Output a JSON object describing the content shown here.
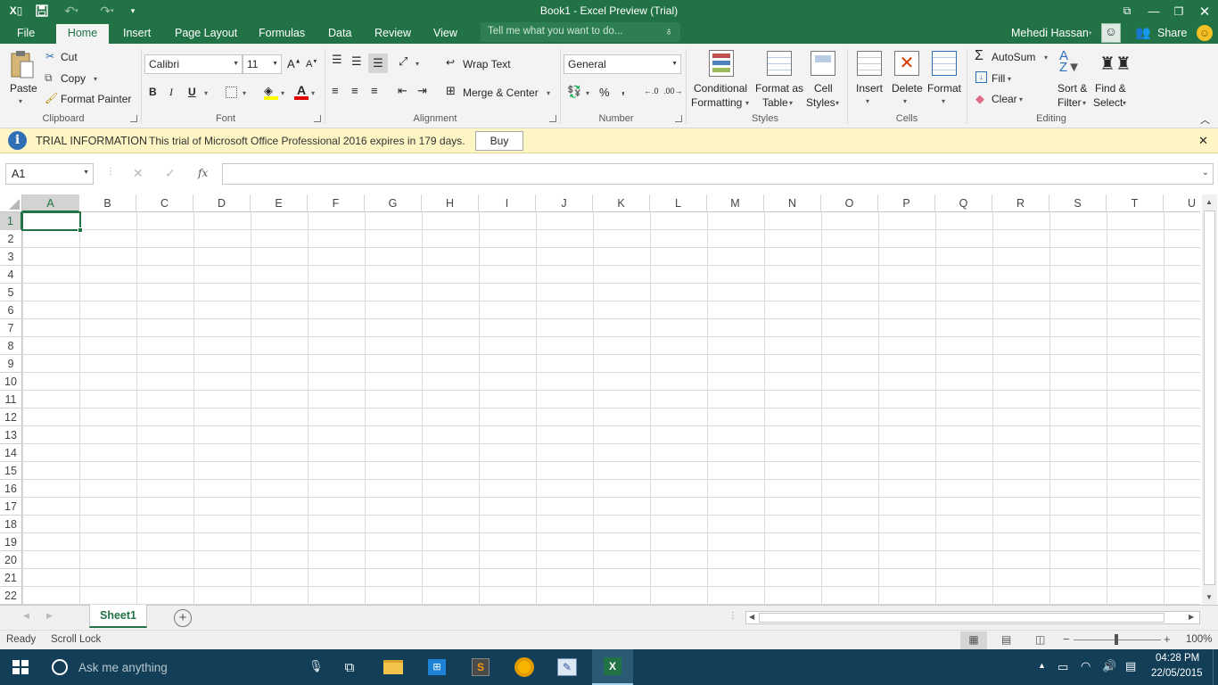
{
  "title": "Book1 - Excel Preview (Trial)",
  "tabs": [
    "File",
    "Home",
    "Insert",
    "Page Layout",
    "Formulas",
    "Data",
    "Review",
    "View"
  ],
  "tell_me": "Tell me what you want to do...",
  "user": "Mehedi Hassan",
  "share": "Share",
  "clipboard": {
    "paste": "Paste",
    "cut": "Cut",
    "copy": "Copy",
    "format_painter": "Format Painter",
    "label": "Clipboard"
  },
  "font": {
    "name": "Calibri",
    "size": "11",
    "bold": "B",
    "italic": "I",
    "underline": "U",
    "label": "Font"
  },
  "alignment": {
    "wrap": "Wrap Text",
    "merge": "Merge & Center",
    "label": "Alignment"
  },
  "number": {
    "format": "General",
    "percent": "%",
    "comma": ",",
    "label": "Number"
  },
  "styles": {
    "conditional_1": "Conditional",
    "conditional_2": "Formatting",
    "format_as_1": "Format as",
    "format_as_2": "Table",
    "cell_styles_1": "Cell",
    "cell_styles_2": "Styles",
    "label": "Styles"
  },
  "cells": {
    "insert": "Insert",
    "delete": "Delete",
    "format": "Format",
    "label": "Cells"
  },
  "editing": {
    "autosum": "AutoSum",
    "fill": "Fill",
    "clear": "Clear",
    "sort_1": "Sort &",
    "sort_2": "Filter",
    "find_1": "Find &",
    "find_2": "Select",
    "label": "Editing"
  },
  "info": {
    "title": "TRIAL INFORMATION",
    "message": "This trial of Microsoft Office Professional 2016 expires in 179 days.",
    "buy": "Buy"
  },
  "name_box": "A1",
  "fx": "fx",
  "columns": [
    "A",
    "B",
    "C",
    "D",
    "E",
    "F",
    "G",
    "H",
    "I",
    "J",
    "K",
    "L",
    "M",
    "N",
    "O",
    "P",
    "Q",
    "R",
    "S",
    "T",
    "U"
  ],
  "rows": [
    "1",
    "2",
    "3",
    "4",
    "5",
    "6",
    "7",
    "8",
    "9",
    "10",
    "11",
    "12",
    "13",
    "14",
    "15",
    "16",
    "17",
    "18",
    "19",
    "20",
    "21",
    "22"
  ],
  "sheet": "Sheet1",
  "status": {
    "ready": "Ready",
    "scroll_lock": "Scroll Lock",
    "zoom": "100%"
  },
  "taskbar": {
    "search": "Ask me anything",
    "time": "04:28 PM",
    "date": "22/05/2015"
  },
  "colors": {
    "excel_green": "#217346",
    "ribbon_bg": "#f3f3f3",
    "info_bg": "#fdf6c4",
    "taskbar": "#133e57"
  }
}
